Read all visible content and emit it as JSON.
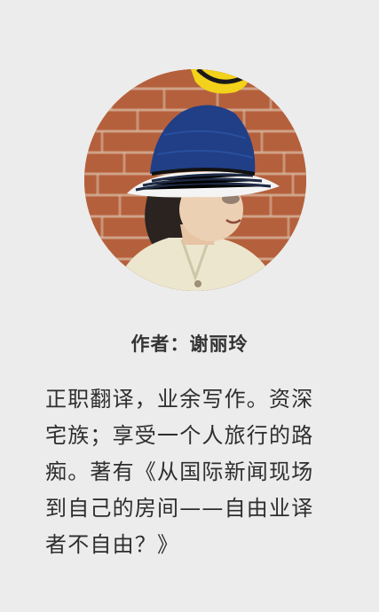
{
  "author": {
    "heading": "作者：谢丽玲"
  },
  "bio": {
    "lines": [
      "正职翻译，业余写作。资深",
      "宅族；享受一个人旅行的路",
      "痴。著有《从国际新闻现场",
      "到自己的房间——自由业译",
      "者不自由？》"
    ]
  },
  "colors": {
    "background": "#ececec",
    "text": "#2e2e2e",
    "hat": "#1f3f86",
    "brick": "#b9643f"
  }
}
